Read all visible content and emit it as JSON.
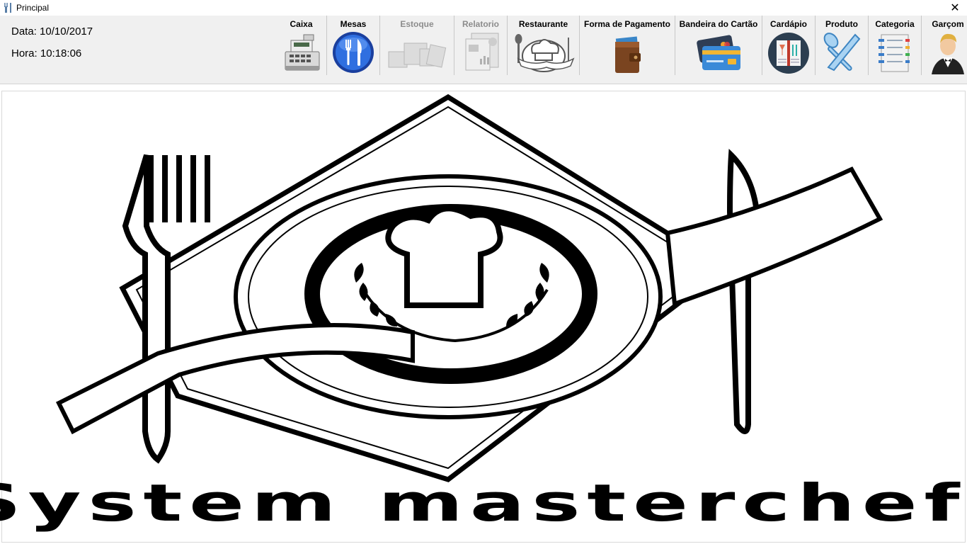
{
  "window": {
    "title": "Principal",
    "close_glyph": "✕"
  },
  "info": {
    "date_label": "Data:",
    "date_value": "10/10/2017",
    "time_label": "Hora:",
    "time_value": "10:18:06"
  },
  "toolbar": [
    {
      "label": "Caixa",
      "icon": "cash-register-icon",
      "enabled": true
    },
    {
      "label": "Mesas",
      "icon": "fork-knife-circle-icon",
      "enabled": true
    },
    {
      "label": "Estoque",
      "icon": "boxes-icon",
      "enabled": false
    },
    {
      "label": "Relatorio",
      "icon": "report-icon",
      "enabled": false
    },
    {
      "label": "Restaurante",
      "icon": "chef-hat-icon",
      "enabled": true
    },
    {
      "label": "Forma de Pagamento",
      "icon": "wallet-icon",
      "enabled": true
    },
    {
      "label": "Bandeira do Cartão",
      "icon": "credit-cards-icon",
      "enabled": true
    },
    {
      "label": "Cardápio",
      "icon": "menu-book-icon",
      "enabled": true
    },
    {
      "label": "Produto",
      "icon": "spoon-knife-icon",
      "enabled": true
    },
    {
      "label": "Categoria",
      "icon": "list-icon",
      "enabled": true
    },
    {
      "label": "Garçom",
      "icon": "waiter-icon",
      "enabled": true
    }
  ],
  "logo": {
    "text": "System  masterchef",
    "icon": "restaurant-logo"
  }
}
